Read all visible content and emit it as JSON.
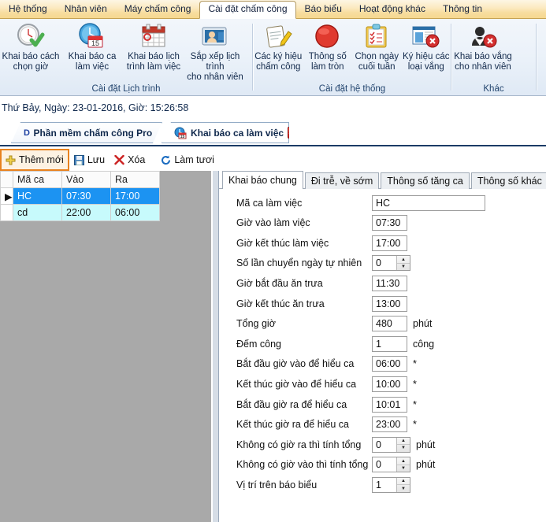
{
  "menubar": {
    "items": [
      {
        "label": "Hệ thống",
        "active": false
      },
      {
        "label": "Nhân viên",
        "active": false
      },
      {
        "label": "Máy chấm công",
        "active": false
      },
      {
        "label": "Cài đặt chấm công",
        "active": true
      },
      {
        "label": "Báo biểu",
        "active": false
      },
      {
        "label": "Hoạt động khác",
        "active": false
      },
      {
        "label": "Thông tin",
        "active": false
      }
    ]
  },
  "ribbon": {
    "groups": [
      {
        "title": "Cài đặt Lịch trình",
        "buttons": [
          {
            "label": "Khai báo cách\nchọn giờ",
            "icon": "clock-check-icon"
          },
          {
            "label": "Khai báo ca\nlàm việc",
            "icon": "clock-calendar-icon"
          },
          {
            "label": "Khai báo lịch\ntrình làm việc",
            "icon": "calendar-icon"
          },
          {
            "label": "Sắp xếp lịch trình\ncho nhân viên",
            "icon": "employee-card-icon"
          }
        ]
      },
      {
        "title": "Cài đặt hệ thống",
        "buttons": [
          {
            "label": "Các ký hiệu\nchấm công",
            "icon": "clipboard-pencil-icon"
          },
          {
            "label": "Thông số\nlàm tròn",
            "icon": "red-circle-icon"
          },
          {
            "label": "Chọn ngày\ncuối tuần",
            "icon": "checklist-icon"
          },
          {
            "label": "Ký hiệu các\nloại vắng",
            "icon": "window-delete-icon"
          }
        ]
      },
      {
        "title": "Khác",
        "buttons": [
          {
            "label": "Khai báo vắng\ncho nhân viên",
            "icon": "user-delete-icon"
          }
        ]
      }
    ]
  },
  "statusline": {
    "text": "Thứ Bảy, Ngày: 23-01-2016, Giờ: 15:26:58"
  },
  "doctabs": [
    {
      "label": "Phần mềm chấm công Pro",
      "logo": "Dexcom",
      "closable": false,
      "active": false
    },
    {
      "label": "Khai báo ca làm việc",
      "icon": "clock-calendar-icon",
      "closable": true,
      "close_label": "✖",
      "active": true
    }
  ],
  "actionbar": {
    "buttons": [
      {
        "label": "Thêm mới",
        "icon": "plus-icon",
        "selected": true
      },
      {
        "label": "Lưu",
        "icon": "save-icon",
        "selected": false
      },
      {
        "label": "Xóa",
        "icon": "delete-x-icon",
        "selected": false
      },
      {
        "label": "Làm tươi",
        "icon": "refresh-icon",
        "selected": false
      }
    ]
  },
  "grid": {
    "columns": [
      "Mã ca",
      "Vào",
      "Ra"
    ],
    "rows": [
      {
        "indicator": "▶",
        "cells": [
          "HC",
          "07:30",
          "17:00"
        ],
        "state": "selected"
      },
      {
        "indicator": "",
        "cells": [
          "cd",
          "22:00",
          "06:00"
        ],
        "state": "alt"
      }
    ]
  },
  "panel": {
    "tabs": [
      {
        "label": "Khai báo chung",
        "active": true
      },
      {
        "label": "Đi trễ, về sớm",
        "active": false
      },
      {
        "label": "Thông số tăng ca",
        "active": false
      },
      {
        "label": "Thông số khác",
        "active": false
      }
    ],
    "fields": [
      {
        "label": "Mã ca làm việc",
        "value": "HC",
        "type": "text-wide",
        "unit": ""
      },
      {
        "label": "Giờ vào làm việc",
        "value": "07:30",
        "type": "text",
        "unit": ""
      },
      {
        "label": "Giờ kết thúc làm việc",
        "value": "17:00",
        "type": "text",
        "unit": ""
      },
      {
        "label": "Số lần chuyển ngày tự nhiên",
        "value": "0",
        "type": "spin",
        "unit": ""
      },
      {
        "label": "Giờ bắt đầu ăn trưa",
        "value": "11:30",
        "type": "text",
        "unit": ""
      },
      {
        "label": "Giờ kết thúc ăn trưa",
        "value": "13:00",
        "type": "text",
        "unit": ""
      },
      {
        "label": "Tổng giờ",
        "value": "480",
        "type": "text",
        "unit": "phút"
      },
      {
        "label": "Đếm công",
        "value": "1",
        "type": "text",
        "unit": "công"
      },
      {
        "label": "Bắt đầu giờ vào để hiểu ca",
        "value": "06:00",
        "type": "text",
        "unit": "*"
      },
      {
        "label": "Kết thúc giờ vào để hiểu ca",
        "value": "10:00",
        "type": "text",
        "unit": "*"
      },
      {
        "label": "Bắt đầu giờ ra để hiểu ca",
        "value": "10:01",
        "type": "text",
        "unit": "*"
      },
      {
        "label": "Kết thúc giờ ra để hiểu ca",
        "value": "23:00",
        "type": "text",
        "unit": "*"
      },
      {
        "label": "Không có giờ ra thì tính tổng",
        "value": "0",
        "type": "spin",
        "unit": "phút"
      },
      {
        "label": "Không có giờ vào thì tính tổng",
        "value": "0",
        "type": "spin",
        "unit": "phút"
      },
      {
        "label": "Vị trí trên báo biểu",
        "value": "1",
        "type": "spin",
        "unit": ""
      }
    ]
  },
  "colors": {
    "menu_accent": "#f6d88f",
    "selection": "#1c93f2",
    "alt_row": "#c7fafc",
    "highlight_border": "#e8821e",
    "tab_underline": "#1b3b66"
  }
}
